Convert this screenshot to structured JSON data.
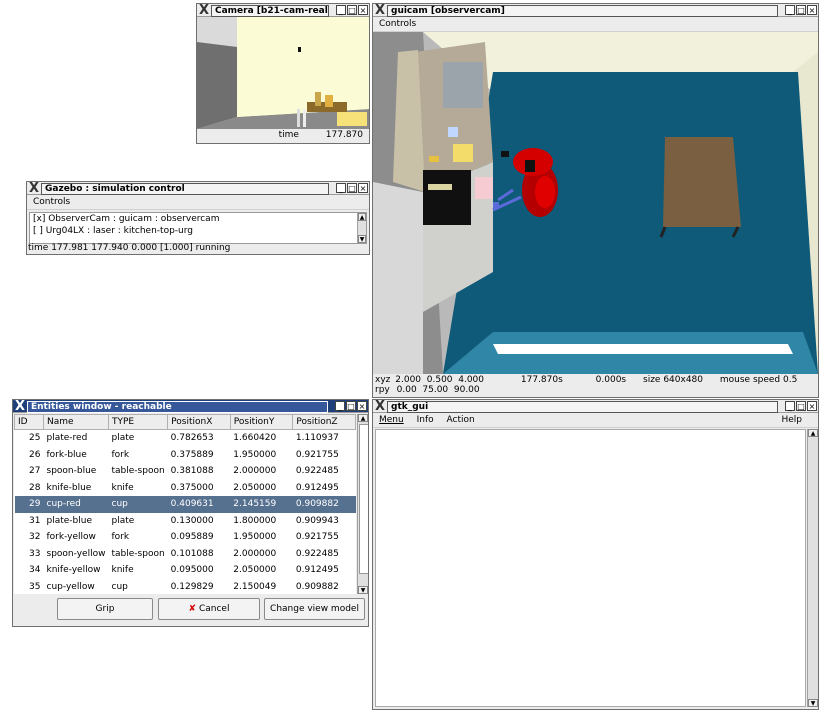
{
  "camera": {
    "title": "Camera [b21-cam-real",
    "time_label": "time",
    "time_value": "177.870"
  },
  "gazebo": {
    "title": "Gazebo : simulation control",
    "menu": "Controls",
    "items": [
      "[x]  ObserverCam : guicam : observercam",
      "[ ]  Urg04LX : laser : kitchen-top-urg"
    ],
    "status": "time 177.981 177.940 0.000 [1.000] running"
  },
  "guicam": {
    "title": "guicam [observercam]",
    "menu": "Controls",
    "xyz_label": "xyz",
    "xyz": "2.000  0.500  4.000",
    "rpy_label": "rpy",
    "rpy": "0.00  75.00  90.00",
    "sim_time": "177.870s",
    "real_time": "0.000s",
    "size": "size 640x480",
    "mouse_speed": "mouse speed 0.5"
  },
  "entities": {
    "title": "Entities window - reachable",
    "columns": [
      "ID",
      "Name",
      "TYPE",
      "PositionX",
      "PositionY",
      "PositionZ"
    ],
    "rows": [
      [
        "25",
        "plate-red",
        "plate",
        "0.782653",
        "1.660420",
        "1.110937"
      ],
      [
        "26",
        "fork-blue",
        "fork",
        "0.375889",
        "1.950000",
        "0.921755"
      ],
      [
        "27",
        "spoon-blue",
        "table-spoon",
        "0.381088",
        "2.000000",
        "0.922485"
      ],
      [
        "28",
        "knife-blue",
        "knife",
        "0.375000",
        "2.050000",
        "0.912495"
      ],
      [
        "29",
        "cup-red",
        "cup",
        "0.409631",
        "2.145159",
        "0.909882"
      ],
      [
        "31",
        "plate-blue",
        "plate",
        "0.130000",
        "1.800000",
        "0.909943"
      ],
      [
        "32",
        "fork-yellow",
        "fork",
        "0.095889",
        "1.950000",
        "0.921755"
      ],
      [
        "33",
        "spoon-yellow",
        "table-spoon",
        "0.101088",
        "2.000000",
        "0.922485"
      ],
      [
        "34",
        "knife-yellow",
        "knife",
        "0.095000",
        "2.050000",
        "0.912495"
      ],
      [
        "35",
        "cup-yellow",
        "cup",
        "0.129829",
        "2.150049",
        "0.909882"
      ]
    ],
    "selected_index": 4,
    "grip_label": "Grip",
    "cancel_label": "Cancel",
    "change_view_label": "Change view model"
  },
  "gtk": {
    "title": "gtk_gui",
    "menus": [
      "Menu",
      "Info",
      "Action"
    ],
    "help": "Help"
  },
  "colors": {
    "floor": "#0e5a78",
    "robot": "#d40000",
    "selection": "#56708f",
    "active_titlebar": "#1e3f7a"
  }
}
